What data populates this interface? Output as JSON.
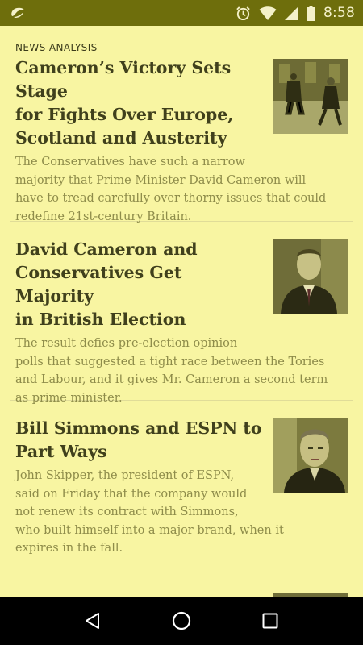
{
  "status_bar": {
    "time": "8:58",
    "icons": [
      "app-logo-icon",
      "alarm-icon",
      "wifi-icon",
      "signal-icon",
      "battery-icon"
    ]
  },
  "articles": [
    {
      "kicker": "NEWS ANALYSIS",
      "headline_lines": [
        "Cameron’s Victory Sets Stage",
        "for Fights Over Europe,",
        "Scotland and Austerity"
      ],
      "summary_lines": [
        "The Conservatives have such a narrow",
        "majority that Prime Minister David Cameron will",
        "have to tread carefully over thorny issues that could",
        "redefine 21st-century Britain."
      ],
      "thumbnail": "downing-street-photo"
    },
    {
      "headline_lines": [
        "David Cameron and",
        "Conservatives Get Majority",
        "in British Election"
      ],
      "summary_lines": [
        "The result defies pre-election opinion",
        "polls that suggested a tight race between the Tories",
        "and Labour, and it gives Mr. Cameron a second term",
        "as prime minister."
      ],
      "thumbnail": "cameron-portrait-photo"
    },
    {
      "headline_lines": [
        "Bill Simmons and ESPN to",
        "Part Ways"
      ],
      "summary_lines": [
        "John Skipper, the president of ESPN,",
        "said on Friday that the company would",
        "not renew its contract with Simmons,",
        "who built himself into a major brand, when it",
        "expires in the fall."
      ],
      "thumbnail": "simmons-portrait-photo"
    }
  ],
  "nav_bar": {
    "icons": [
      "back-icon",
      "home-icon",
      "recents-icon"
    ]
  }
}
